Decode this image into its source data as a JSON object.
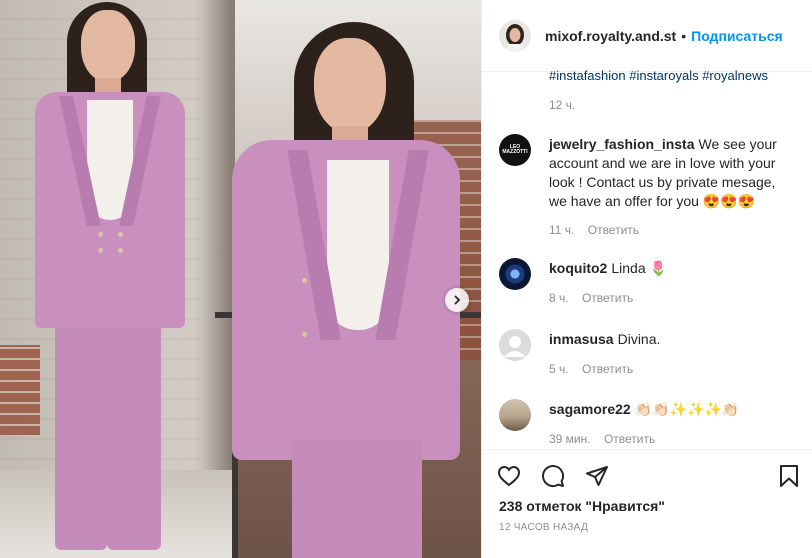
{
  "header": {
    "username": "mixof.royalty.and.st",
    "separator": "•",
    "follow_label": "Подписаться"
  },
  "caption": {
    "hashtags": "#instafashion #instaroyals #royalnews",
    "time": "12 ч."
  },
  "comments": [
    {
      "username": "jewelry_fashion_insta",
      "avatar_text": "LEO MAZZOTTI",
      "text": "We see your account and we are in love with your look ! Contact us by private mesage, we have an offer for you 😍😍😍",
      "time": "11 ч.",
      "reply": "Ответить"
    },
    {
      "username": "koquito2",
      "text": "Linda 🌷",
      "time": "8 ч.",
      "reply": "Ответить"
    },
    {
      "username": "inmasusa",
      "text": "Divina.",
      "time": "5 ч.",
      "reply": "Ответить"
    },
    {
      "username": "sagamore22",
      "text": "👏🏻👏🏻✨✨✨👏🏻",
      "time": "39 мин.",
      "reply": "Ответить"
    }
  ],
  "actions": {
    "icons": [
      "heart-icon",
      "comment-icon",
      "share-icon",
      "bookmark-icon"
    ]
  },
  "likes": "238 отметок \"Нравится\"",
  "timestamp": "12 часов назад",
  "colors": {
    "link": "#0095f6",
    "hashtag": "#00376b",
    "meta": "#8e8e8e",
    "suit": "#c98fbf"
  }
}
